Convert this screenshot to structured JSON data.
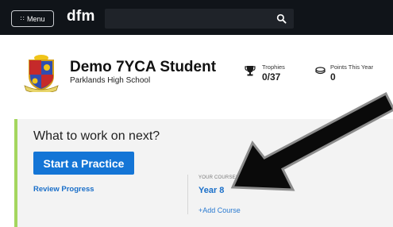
{
  "nav": {
    "menu_label": "Menu",
    "menu_icon": "grip-dots-icon",
    "logo_text": "dfm",
    "search_value": "",
    "search_icon": "search-icon"
  },
  "profile": {
    "student_name": "Demo 7YCA Student",
    "school_name": "Parklands High School",
    "crest_icon": "school-crest-icon"
  },
  "stats": {
    "trophies_label": "Trophies",
    "trophies_value": "0/37",
    "trophies_icon": "trophy-icon",
    "points_label": "Points This Year",
    "points_value": "0",
    "points_icon": "points-coin-icon"
  },
  "next_card": {
    "title": "What to work on next?",
    "practice_button": "Start a Practice",
    "review_link": "Review Progress",
    "courses_label": "YOUR COURSES",
    "course_name": "Year 8",
    "add_course": "+Add Course"
  },
  "annotation": {
    "arrow_icon": "pointer-arrow-icon"
  },
  "colors": {
    "nav_bg": "#101419",
    "accent_blue": "#1475d6",
    "link_blue": "#1a6fc9",
    "card_accent_green": "#a4d65e",
    "card_bg": "#f3f3f3"
  }
}
